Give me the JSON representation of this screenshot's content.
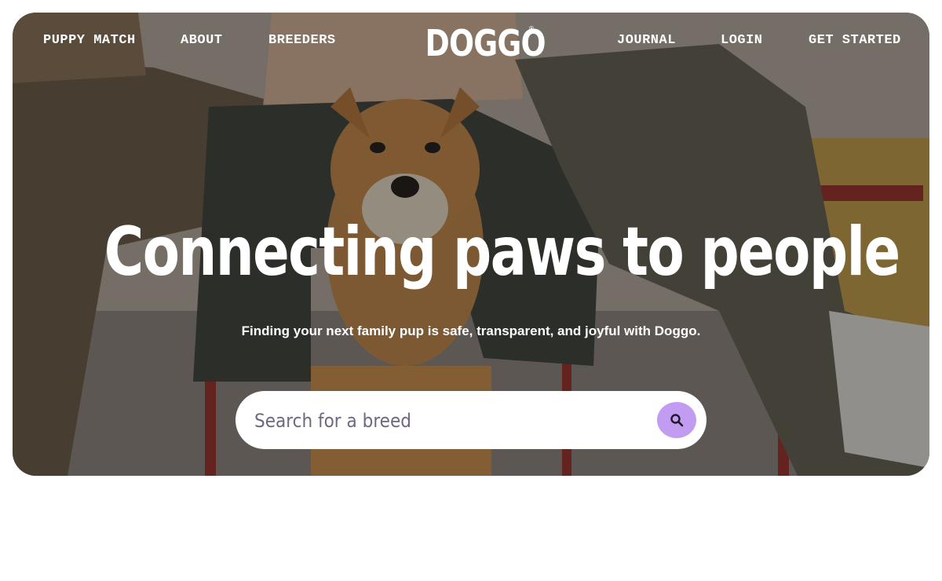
{
  "nav": {
    "left": [
      "PUPPY MATCH",
      "ABOUT",
      "BREEDERS"
    ],
    "right": [
      "JOURNAL",
      "LOGIN",
      "GET STARTED"
    ]
  },
  "logo": {
    "text": "DOGGO",
    "mark": "®"
  },
  "hero": {
    "headline": "Connecting paws to people",
    "subtitle": "Finding your next family pup is safe, transparent, and joyful with Doggo."
  },
  "search": {
    "placeholder": "Search for a breed",
    "button_icon": "search-icon",
    "button_color": "#c29cf0"
  },
  "colors": {
    "text": "#ffffff",
    "page_bg": "#ffffff"
  }
}
